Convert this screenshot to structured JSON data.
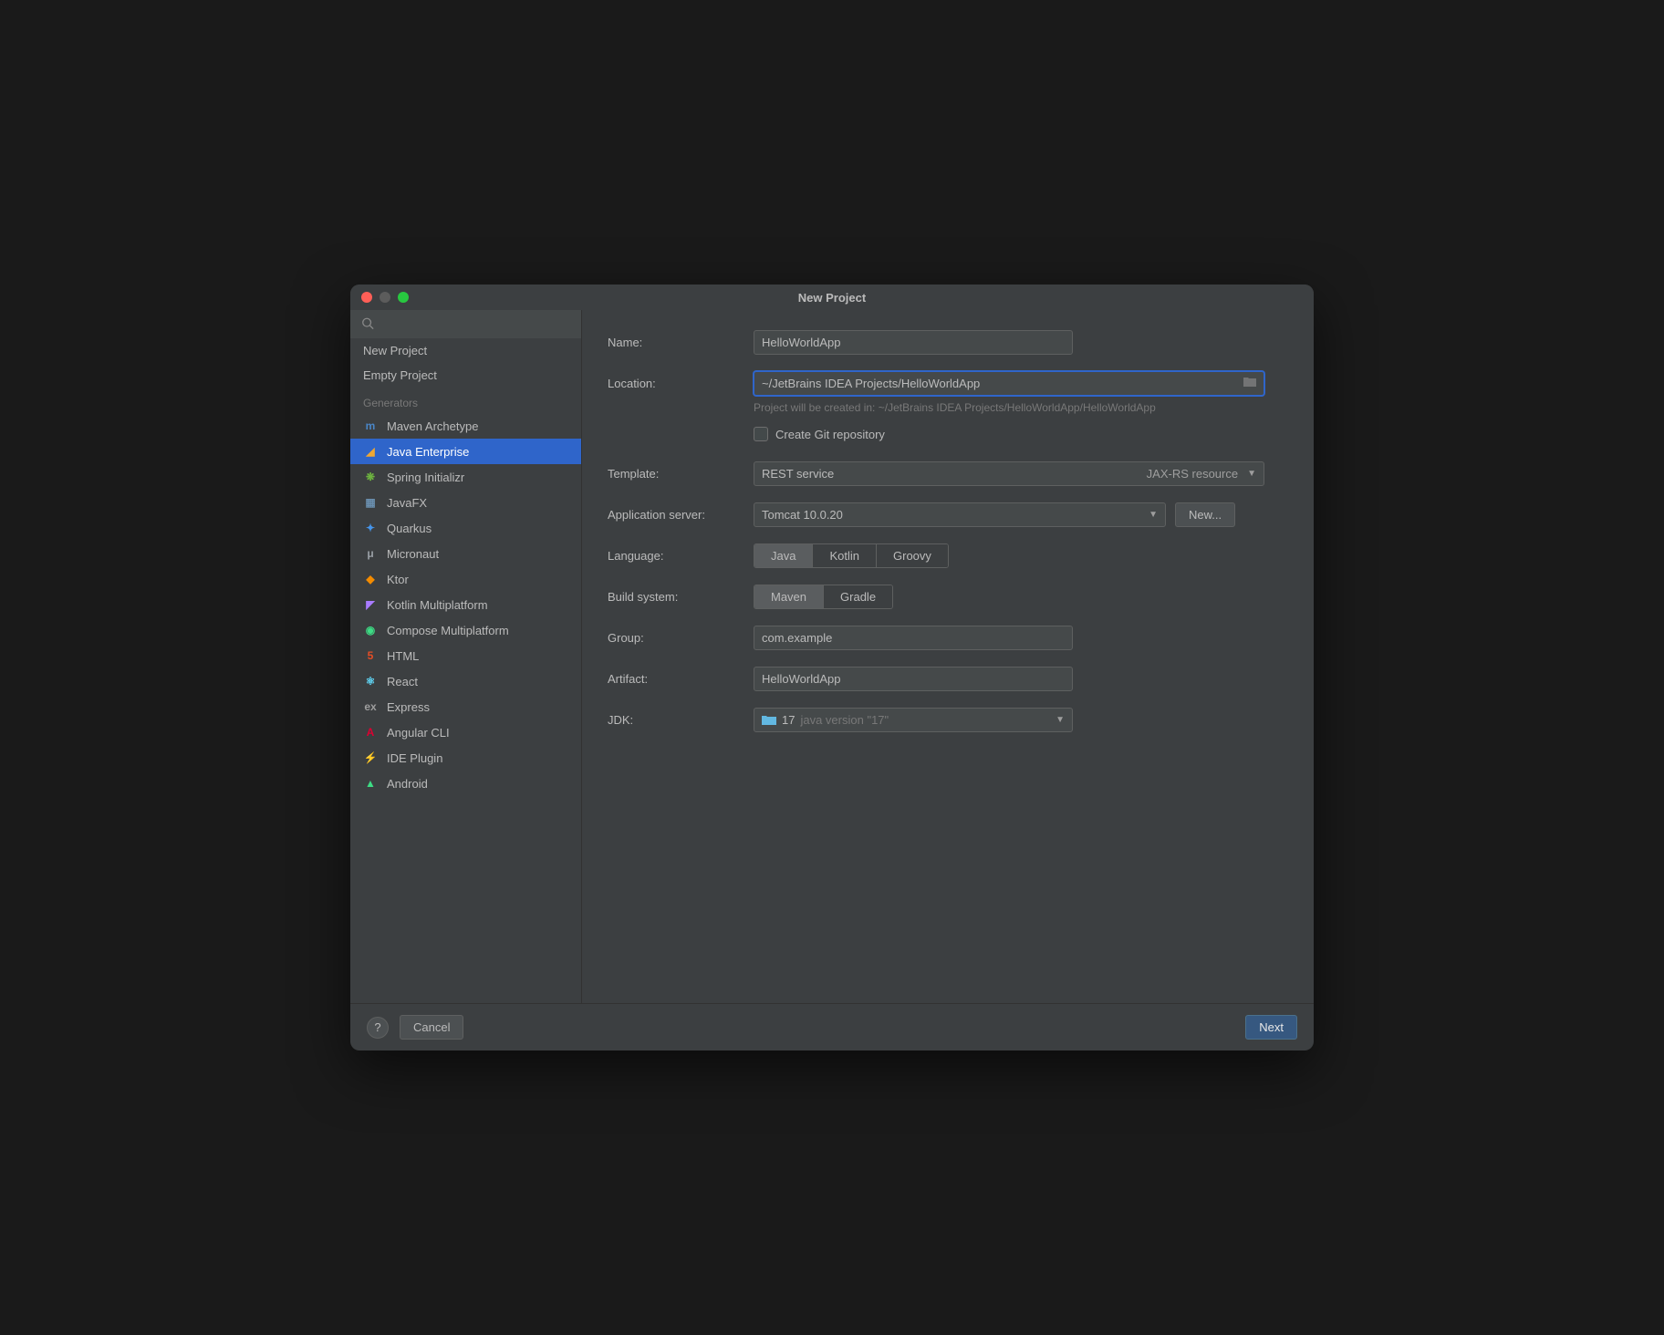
{
  "window": {
    "title": "New Project"
  },
  "sidebar": {
    "search_placeholder": "",
    "top": [
      {
        "label": "New Project"
      },
      {
        "label": "Empty Project"
      }
    ],
    "generators_header": "Generators",
    "generators": [
      {
        "label": "Maven Archetype",
        "icon": "maven-icon",
        "color": "#4a86c7",
        "glyph": "m"
      },
      {
        "label": "Java Enterprise",
        "icon": "java-ee-icon",
        "color": "#f0a732",
        "glyph": "◢",
        "selected": true
      },
      {
        "label": "Spring Initializr",
        "icon": "spring-icon",
        "color": "#6db33f",
        "glyph": "❋"
      },
      {
        "label": "JavaFX",
        "icon": "javafx-icon",
        "color": "#6a8faf",
        "glyph": "▦"
      },
      {
        "label": "Quarkus",
        "icon": "quarkus-icon",
        "color": "#4695eb",
        "glyph": "✦"
      },
      {
        "label": "Micronaut",
        "icon": "micronaut-icon",
        "color": "#9aa0a6",
        "glyph": "μ"
      },
      {
        "label": "Ktor",
        "icon": "ktor-icon",
        "color": "#f38b00",
        "glyph": "◆"
      },
      {
        "label": "Kotlin Multiplatform",
        "icon": "kotlin-icon",
        "color": "#a97bff",
        "glyph": "◤"
      },
      {
        "label": "Compose Multiplatform",
        "icon": "compose-icon",
        "color": "#3ddc84",
        "glyph": "◉"
      },
      {
        "label": "HTML",
        "icon": "html-icon",
        "color": "#e44d26",
        "glyph": "5"
      },
      {
        "label": "React",
        "icon": "react-icon",
        "color": "#61dafb",
        "glyph": "⚛"
      },
      {
        "label": "Express",
        "icon": "express-icon",
        "color": "#9e9e9e",
        "glyph": "ex"
      },
      {
        "label": "Angular CLI",
        "icon": "angular-icon",
        "color": "#dd0031",
        "glyph": "A"
      },
      {
        "label": "IDE Plugin",
        "icon": "plugin-icon",
        "color": "#c0c0c0",
        "glyph": "⚡"
      },
      {
        "label": "Android",
        "icon": "android-icon",
        "color": "#3ddc84",
        "glyph": "▲"
      }
    ]
  },
  "form": {
    "name_label": "Name:",
    "name_value": "HelloWorldApp",
    "location_label": "Location:",
    "location_value": "~/JetBrains IDEA Projects/HelloWorldApp",
    "location_hint": "Project will be created in: ~/JetBrains IDEA Projects/HelloWorldApp/HelloWorldApp",
    "git_label": "Create Git repository",
    "template_label": "Template:",
    "template_value": "REST service",
    "template_extra": "JAX-RS resource",
    "appserver_label": "Application server:",
    "appserver_value": "Tomcat 10.0.20",
    "appserver_new": "New...",
    "language_label": "Language:",
    "language_options": [
      "Java",
      "Kotlin",
      "Groovy"
    ],
    "language_selected": "Java",
    "build_label": "Build system:",
    "build_options": [
      "Maven",
      "Gradle"
    ],
    "build_selected": "Maven",
    "group_label": "Group:",
    "group_value": "com.example",
    "artifact_label": "Artifact:",
    "artifact_value": "HelloWorldApp",
    "jdk_label": "JDK:",
    "jdk_version": "17",
    "jdk_desc": "java version \"17\""
  },
  "footer": {
    "cancel": "Cancel",
    "next": "Next"
  }
}
